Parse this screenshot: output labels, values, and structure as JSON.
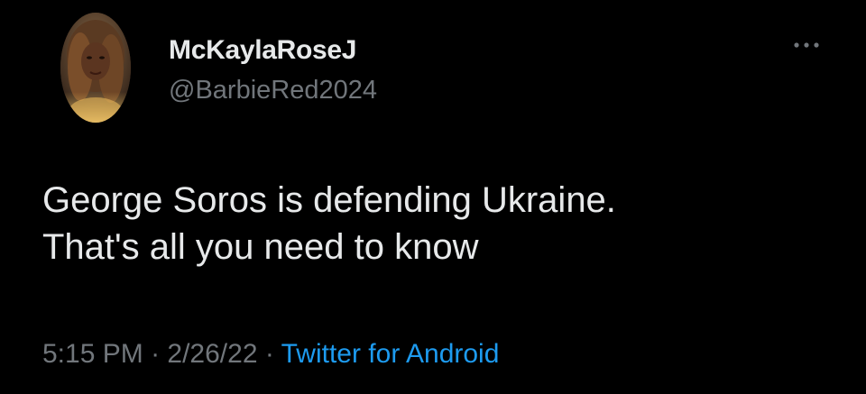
{
  "author": {
    "display_name": "McKaylaRoseJ",
    "handle": "@BarbieRed2024",
    "avatar_icon": "profile-photo"
  },
  "tweet": {
    "lines": [
      "George Soros is defending Ukraine.",
      "That's all you need to know"
    ]
  },
  "meta": {
    "time": "5:15 PM",
    "separator": " · ",
    "date": "2/26/22",
    "source": "Twitter for Android"
  },
  "icons": {
    "more": "more-options-icon"
  },
  "colors": {
    "background": "#000000",
    "primary_text": "#e7e9ea",
    "secondary_text": "#71767b",
    "link": "#1d9bf0"
  }
}
